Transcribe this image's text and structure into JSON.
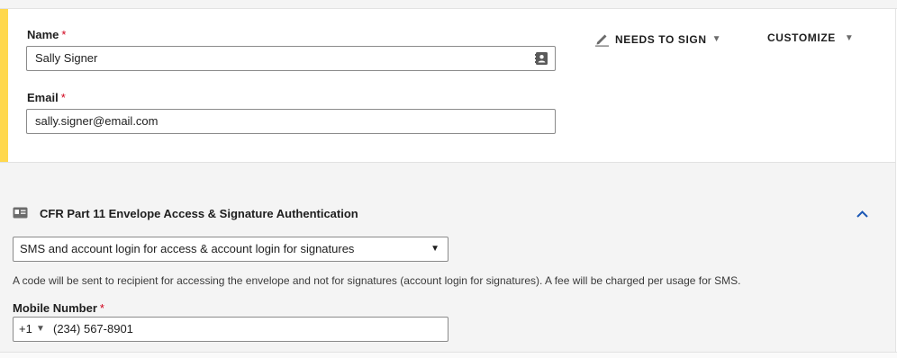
{
  "recipient": {
    "name_label": "Name",
    "name_value": "Sally Signer",
    "email_label": "Email",
    "email_value": "sally.signer@email.com",
    "required_marker": "*",
    "needs_to_sign_label": "NEEDS TO SIGN",
    "customize_label": "CUSTOMIZE",
    "accent_color": "#ffd84d"
  },
  "auth": {
    "title": "CFR Part 11 Envelope Access & Signature Authentication",
    "selected_option": "SMS and account login for access & account login for signatures",
    "helper_text": "A code will be sent to recipient for accessing the envelope and not for signatures (account login for signatures). A fee will be charged per usage for SMS.",
    "mobile_label": "Mobile Number",
    "country_code": "+1",
    "phone_value": "(234) 567-8901",
    "collapse_color": "#1a57b5"
  },
  "icons": {
    "contact": "address-book-icon",
    "pen": "pen-icon",
    "id_card": "id-card-icon",
    "caret": "caret-down-icon",
    "chevron": "chevron-up-icon"
  }
}
